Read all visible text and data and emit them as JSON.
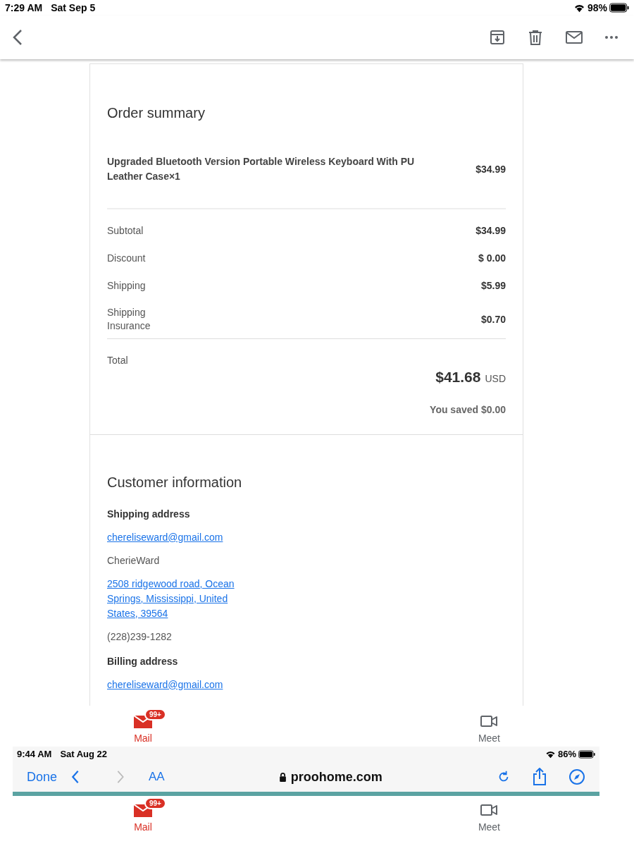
{
  "status_bar": {
    "time": "7:29 AM",
    "date": "Sat Sep 5",
    "battery_text": "98%"
  },
  "order_summary": {
    "title": "Order summary",
    "items": [
      {
        "name": "Upgraded Bluetooth Version Portable Wireless Keyboard With PU Leather Case×1",
        "price": "$34.99"
      }
    ],
    "totals": [
      {
        "label": "Subtotal",
        "value": "$34.99"
      },
      {
        "label": "Discount",
        "value": "$ 0.00"
      },
      {
        "label": "Shipping",
        "value": "$5.99"
      },
      {
        "label": "Shipping Insurance",
        "value": "$0.70"
      }
    ],
    "total": {
      "label": "Total",
      "amount": "$41.68",
      "currency": "USD"
    },
    "saved": "You saved $0.00"
  },
  "customer_information": {
    "title": "Customer information",
    "sections": [
      {
        "heading": "Shipping address",
        "lines": [
          {
            "kind": "link",
            "text": "chereliseward@gmail.com"
          },
          {
            "kind": "text",
            "text": "CherieWard"
          },
          {
            "kind": "link",
            "text": "2508 ridgewood road, Ocean Springs, Mississippi, United States, 39564"
          },
          {
            "kind": "text",
            "text": "(228)239-1282"
          }
        ]
      },
      {
        "heading": "Billing address",
        "lines": [
          {
            "kind": "link",
            "text": "chereliseward@gmail.com"
          }
        ]
      }
    ]
  },
  "tab_bar": [
    {
      "label": "Mail",
      "badge": "99+",
      "selected": true
    },
    {
      "label": "Meet",
      "selected": false
    }
  ],
  "embedded_screenshot": {
    "status_bar": {
      "time": "9:44 AM",
      "date": "Sat Aug 22",
      "battery_text": "86%"
    },
    "browser_bar": {
      "done": "Done",
      "text_size": "AA",
      "url": "proohome.com"
    },
    "tab_bar": [
      {
        "label": "Mail",
        "badge": "99+",
        "selected": true
      },
      {
        "label": "Meet",
        "selected": false
      }
    ]
  }
}
